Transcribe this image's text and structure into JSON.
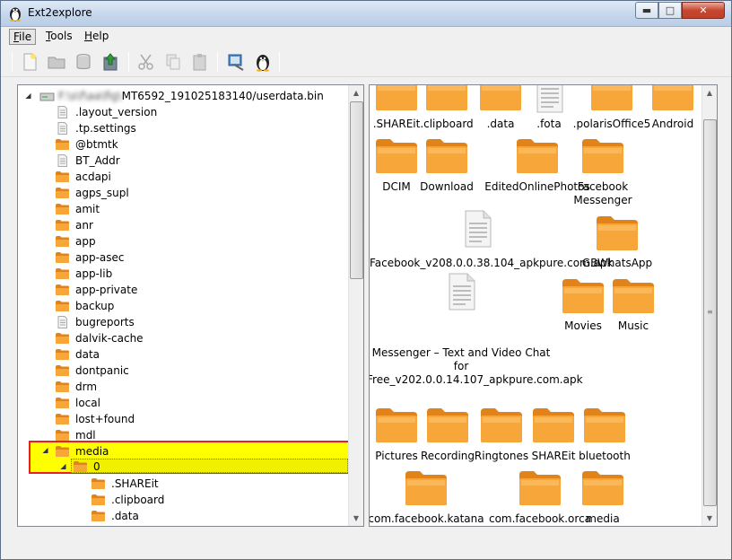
{
  "window": {
    "title": "Ext2explore"
  },
  "menu": [
    {
      "label": "File",
      "key": "F",
      "rest": "ile"
    },
    {
      "label": "Tools",
      "key": "T",
      "rest": "ools"
    },
    {
      "label": "Help",
      "key": "H",
      "rest": "elp"
    }
  ],
  "toolbar": [
    {
      "name": "new-icon"
    },
    {
      "name": "open-folder-icon"
    },
    {
      "name": "disk-icon"
    },
    {
      "name": "save-arrow-icon"
    },
    {
      "name": "cut-icon"
    },
    {
      "name": "copy-icon"
    },
    {
      "name": "paste-icon"
    },
    {
      "name": "properties-icon"
    },
    {
      "name": "linux-penguin-icon"
    }
  ],
  "tree": {
    "root_label": "MT6592_191025183140/userdata.bin",
    "root_prefix_blurred": "F:\\s\\f\\aa\\fig\\",
    "items": [
      {
        "label": ".layout_version",
        "type": "file"
      },
      {
        "label": ".tp.settings",
        "type": "file"
      },
      {
        "label": "@btmtk",
        "type": "folder"
      },
      {
        "label": "BT_Addr",
        "type": "file"
      },
      {
        "label": "acdapi",
        "type": "folder"
      },
      {
        "label": "agps_supl",
        "type": "folder"
      },
      {
        "label": "amit",
        "type": "folder"
      },
      {
        "label": "anr",
        "type": "folder"
      },
      {
        "label": "app",
        "type": "folder"
      },
      {
        "label": "app-asec",
        "type": "folder"
      },
      {
        "label": "app-lib",
        "type": "folder"
      },
      {
        "label": "app-private",
        "type": "folder"
      },
      {
        "label": "backup",
        "type": "folder"
      },
      {
        "label": "bugreports",
        "type": "file"
      },
      {
        "label": "dalvik-cache",
        "type": "folder"
      },
      {
        "label": "data",
        "type": "folder"
      },
      {
        "label": "dontpanic",
        "type": "folder"
      },
      {
        "label": "drm",
        "type": "folder"
      },
      {
        "label": "local",
        "type": "folder"
      },
      {
        "label": "lost+found",
        "type": "folder"
      },
      {
        "label": "mdl",
        "type": "folder"
      }
    ],
    "media_label": "media",
    "zero_label": "0",
    "sub_items": [
      {
        "label": ".SHAREit"
      },
      {
        "label": ".clipboard"
      },
      {
        "label": ".data"
      }
    ]
  },
  "grid": [
    {
      "label": ".SHAREit",
      "type": "folder"
    },
    {
      "label": ".clipboard",
      "type": "folder"
    },
    {
      "label": ".data",
      "type": "folder"
    },
    {
      "label": ".fota",
      "type": "file"
    },
    {
      "label": ".polarisOffice5",
      "type": "folder"
    },
    {
      "label": "Android",
      "type": "folder"
    },
    {
      "label": "DCIM",
      "type": "folder"
    },
    {
      "label": "Download",
      "type": "folder"
    },
    {
      "label": "EditedOnlinePhotos",
      "type": "folder"
    },
    {
      "label": "Facebook Messenger",
      "type": "folder"
    },
    {
      "label": "Facebook_v208.0.0.38.104_apkpure.com.apk",
      "type": "file"
    },
    {
      "label": "GBWhatsApp",
      "type": "folder"
    },
    {
      "label": "Messenger – Text and Video Chat for Free_v202.0.0.14.107_apkpure.com.apk",
      "type": "file"
    },
    {
      "label": "Movies",
      "type": "folder"
    },
    {
      "label": "Music",
      "type": "folder"
    },
    {
      "label": "Pictures",
      "type": "folder"
    },
    {
      "label": "Recording",
      "type": "folder"
    },
    {
      "label": "Ringtones",
      "type": "folder"
    },
    {
      "label": "SHAREit",
      "type": "folder"
    },
    {
      "label": "bluetooth",
      "type": "folder"
    },
    {
      "label": "com.facebook.katana",
      "type": "folder"
    },
    {
      "label": "com.facebook.orca",
      "type": "folder"
    },
    {
      "label": "media",
      "type": "folder"
    }
  ],
  "colors": {
    "highlight": "#ffff00",
    "highlight_border": "#e8211c",
    "folder": "#f59a28"
  }
}
